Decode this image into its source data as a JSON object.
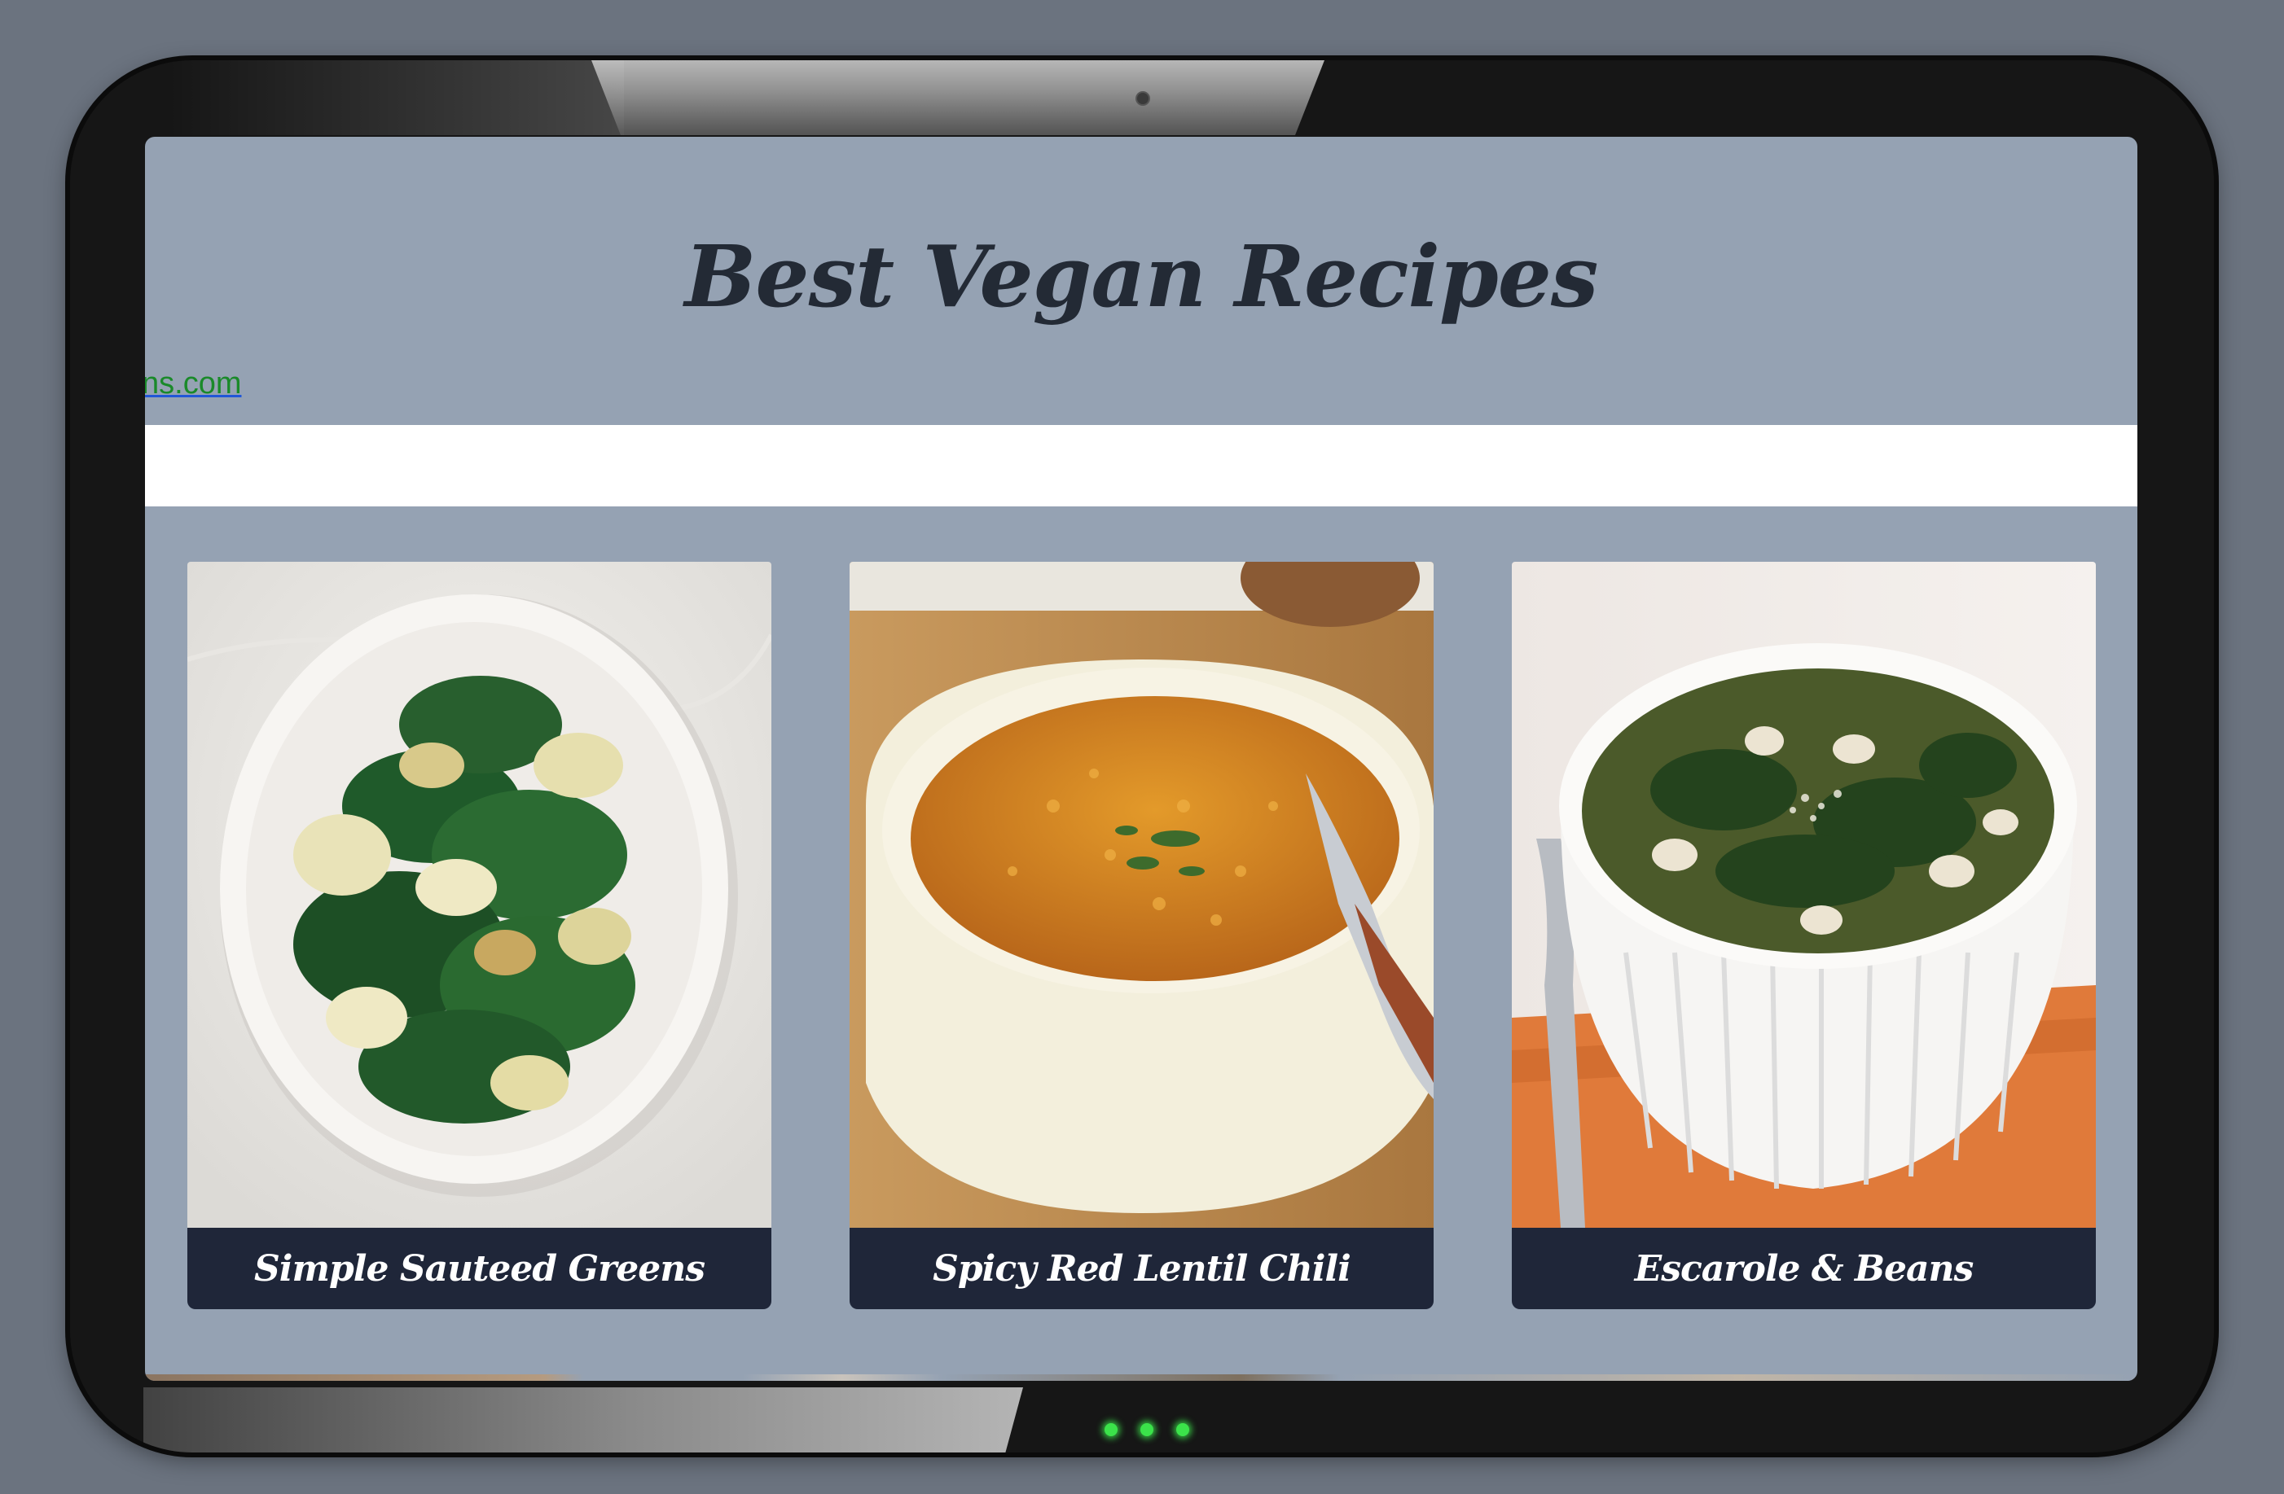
{
  "page": {
    "title": "Best Vegan Recipes",
    "site_link": "ns.com"
  },
  "recipes": [
    {
      "name": "Simple Sauteed Greens",
      "image": "sauteed-greens-photo"
    },
    {
      "name": "Spicy Red Lentil Chili",
      "image": "lentil-chili-photo"
    },
    {
      "name": "Escarole & Beans",
      "image": "escarole-beans-photo"
    }
  ],
  "colors": {
    "page_background": "#95a2b3",
    "caption_background": "#1f2639",
    "title_text": "#232a35",
    "link_text": "#1a8a2a"
  }
}
